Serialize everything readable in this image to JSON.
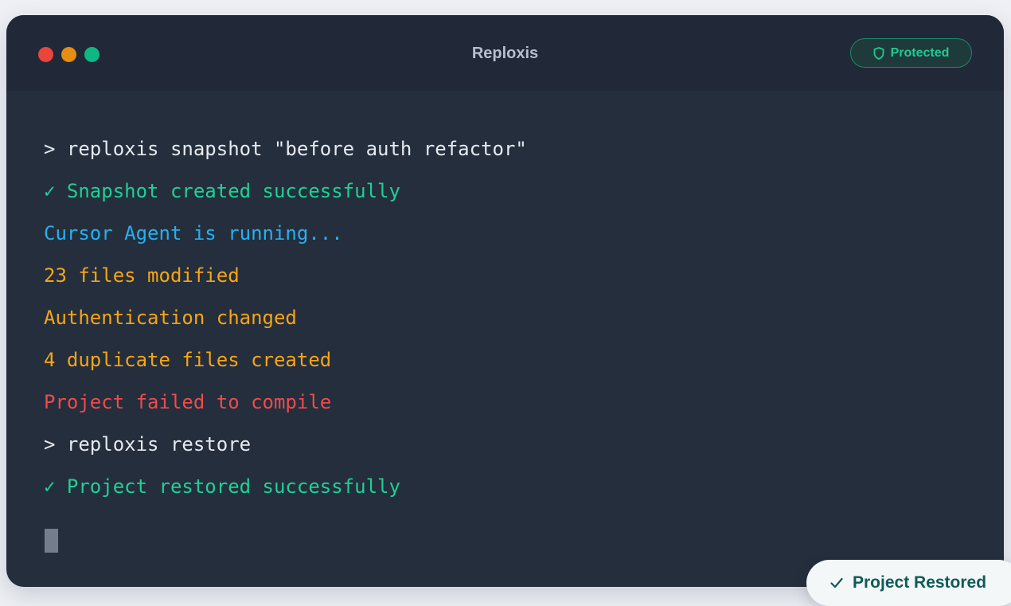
{
  "window": {
    "title": "Reploxis",
    "traffic_lights": [
      {
        "name": "close",
        "color": "#e9453d"
      },
      {
        "name": "minimize",
        "color": "#e58e12"
      },
      {
        "name": "maximize",
        "color": "#0fb882"
      }
    ],
    "badge": {
      "icon": "shield-icon",
      "label": "Protected",
      "color": "#22c991"
    }
  },
  "terminal": {
    "lines": [
      {
        "text": "> reploxis snapshot \"before auth refactor\"",
        "color": "#e6e9ef"
      },
      {
        "text": "✓ Snapshot created successfully",
        "color": "#1fd095"
      },
      {
        "text": "Cursor Agent is running...",
        "color": "#27b0ee"
      },
      {
        "text": "23 files modified",
        "color": "#f5a516"
      },
      {
        "text": "Authentication changed",
        "color": "#f5a516"
      },
      {
        "text": "4 duplicate files created",
        "color": "#f5a516"
      },
      {
        "text": "Project failed to compile",
        "color": "#f04a4c"
      },
      {
        "text": "> reploxis restore",
        "color": "#e6e9ef"
      },
      {
        "text": "✓ Project restored successfully",
        "color": "#1fd095"
      }
    ]
  },
  "toast": {
    "icon": "check-icon",
    "label": "Project Restored",
    "color": "#0f5a5a"
  }
}
